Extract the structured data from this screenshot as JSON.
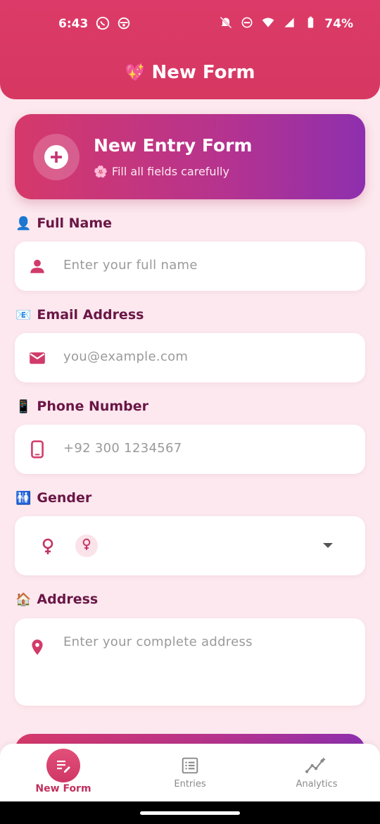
{
  "status_bar": {
    "time": "6:43",
    "battery": "74%",
    "icons": [
      "whatsapp-icon",
      "app-notification-icon",
      "mute-icon",
      "dnd-icon",
      "wifi-icon",
      "signal-icon",
      "battery-icon"
    ]
  },
  "app_bar": {
    "emoji": "💖",
    "title": "New Form"
  },
  "hero": {
    "title": "New Entry Form",
    "subtitle_emoji": "🌸",
    "subtitle": "Fill all fields carefully",
    "icon": "add-circle-icon"
  },
  "fields": {
    "full_name": {
      "emoji": "👤",
      "label": "Full Name",
      "placeholder": "Enter your full name",
      "icon": "person-icon"
    },
    "email": {
      "emoji": "📧",
      "label": "Email Address",
      "placeholder": "you@example.com",
      "icon": "mail-icon"
    },
    "phone": {
      "emoji": "📱",
      "label": "Phone Number",
      "placeholder": "+92 300 1234567",
      "icon": "phone-icon"
    },
    "gender": {
      "emoji": "🚻",
      "label": "Gender",
      "selected_value": "",
      "icon": "female-icon"
    },
    "address": {
      "emoji": "🏠",
      "label": "Address",
      "placeholder": "Enter your complete address",
      "icon": "location-pin-icon"
    }
  },
  "bottom_nav": {
    "items": [
      {
        "label": "New Form",
        "icon": "edit-note-icon",
        "active": true
      },
      {
        "label": "Entries",
        "icon": "list-icon",
        "active": false
      },
      {
        "label": "Analytics",
        "icon": "analytics-icon",
        "active": false
      }
    ]
  },
  "colors": {
    "primary": "#d6396a",
    "accent_purple": "#8e2fae",
    "label_text": "#6a1646",
    "background": "#fce8ee"
  }
}
